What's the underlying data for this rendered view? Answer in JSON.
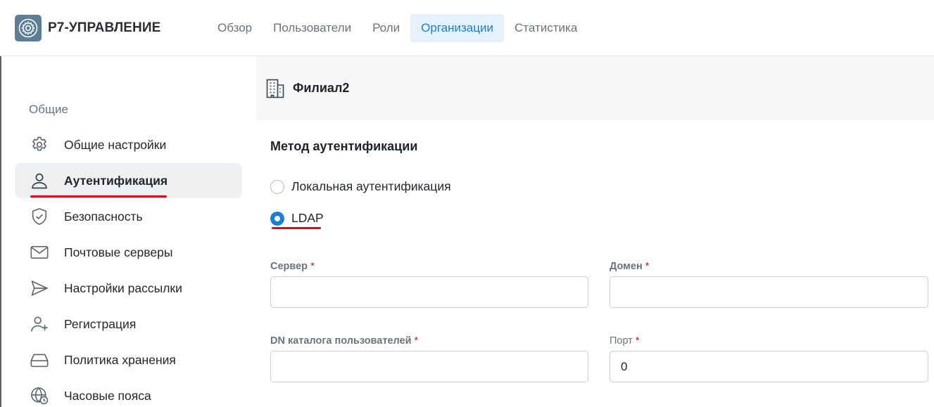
{
  "app": {
    "title": "Р7-УПРАВЛЕНИЕ",
    "logo_icon": "gear-icon",
    "brand_color": "#5b7d96"
  },
  "nav": {
    "items": [
      {
        "label": "Обзор",
        "active": false
      },
      {
        "label": "Пользователи",
        "active": false
      },
      {
        "label": "Роли",
        "active": false
      },
      {
        "label": "Организации",
        "active": true
      },
      {
        "label": "Статистика",
        "active": false
      }
    ],
    "active_color": "#1a7fd0"
  },
  "sidebar": {
    "group_label": "Общие",
    "items": [
      {
        "label": "Общие настройки",
        "icon": "gear-icon",
        "active": false
      },
      {
        "label": "Аутентификация",
        "icon": "user-icon",
        "active": true
      },
      {
        "label": "Безопасность",
        "icon": "shield-check-icon",
        "active": false
      },
      {
        "label": "Почтовые серверы",
        "icon": "mail-icon",
        "active": false
      },
      {
        "label": "Настройки рассылки",
        "icon": "send-icon",
        "active": false
      },
      {
        "label": "Регистрация",
        "icon": "user-plus-icon",
        "active": false
      },
      {
        "label": "Политика хранения",
        "icon": "storage-drive-icon",
        "active": false
      },
      {
        "label": "Часовые пояса",
        "icon": "globe-clock-icon",
        "active": false
      }
    ]
  },
  "page": {
    "title": "Филиал2",
    "icon": "building-icon"
  },
  "auth": {
    "section_title": "Метод аутентификации",
    "options": [
      {
        "label": "Локальная аутентификация",
        "checked": false
      },
      {
        "label": "LDAP",
        "checked": true
      }
    ]
  },
  "form": {
    "server": {
      "label": "Сервер",
      "required_mark": "*",
      "value": ""
    },
    "domain": {
      "label": "Домен",
      "required_mark": "*",
      "value": ""
    },
    "dn": {
      "label": "DN каталога пользователей",
      "required_mark": "*",
      "value": ""
    },
    "port": {
      "label": "Порт",
      "required_mark": "*",
      "value": "0"
    }
  },
  "highlight_color": "#e0081b"
}
